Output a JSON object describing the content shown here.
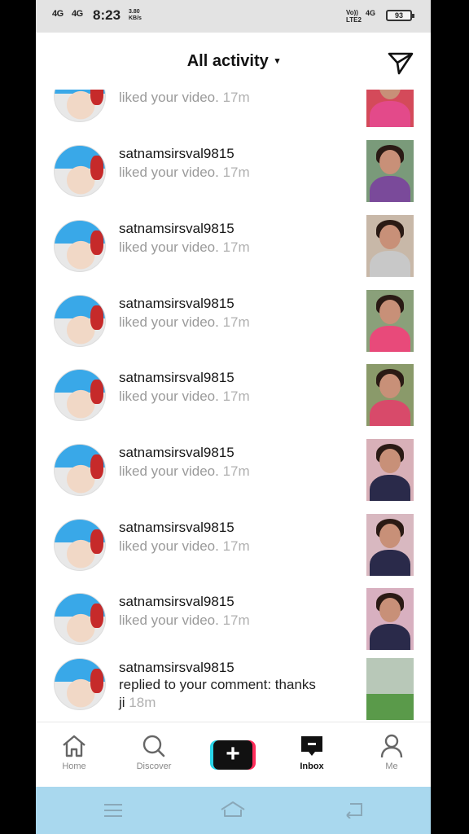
{
  "status_bar": {
    "signal_1": "4G",
    "signal_2": "4G",
    "time": "8:23",
    "speed_value": "3.80",
    "speed_unit": "KB/s",
    "volte": "Vo))",
    "lte": "LTE2",
    "network": "4G",
    "battery": "93"
  },
  "header": {
    "title": "All activity",
    "title_caret": "▾",
    "send_icon": "paper-plane-icon"
  },
  "notifications": [
    {
      "username": "",
      "action": "liked your video.",
      "time": "17m",
      "thumb": {
        "bg": "#d44a5a",
        "body": "#e34a8a"
      }
    },
    {
      "username": "satnamsirsval9815",
      "action": "liked your video.",
      "time": "17m",
      "thumb": {
        "bg": "#7a9a7a",
        "body": "#7a4a9a"
      }
    },
    {
      "username": "satnamsirsval9815",
      "action": "liked your video.",
      "time": "17m",
      "thumb": {
        "bg": "#c8b8a8",
        "body": "#c8c8c8"
      }
    },
    {
      "username": "satnamsirsval9815",
      "action": "liked your video.",
      "time": "17m",
      "thumb": {
        "bg": "#8aa07a",
        "body": "#e84a7a"
      }
    },
    {
      "username": "satnamsirsval9815",
      "action": "liked your video.",
      "time": "17m",
      "thumb": {
        "bg": "#8a9a6a",
        "body": "#d84a6a"
      }
    },
    {
      "username": "satnamsirsval9815",
      "action": "liked your video.",
      "time": "17m",
      "thumb": {
        "bg": "#d8b0b8",
        "body": "#2a2a4a"
      }
    },
    {
      "username": "satnamsirsval9815",
      "action": "liked your video.",
      "time": "17m",
      "thumb": {
        "bg": "#d8b8c0",
        "body": "#2a2a4a"
      }
    },
    {
      "username": "satnamsirsval9815",
      "action": "liked your video.",
      "time": "17m",
      "thumb": {
        "bg": "#d8b0c0",
        "body": "#2a2a4a"
      }
    }
  ],
  "comment_notification": {
    "username": "satnamsirsval9815",
    "text_line1": "replied to your comment: thanks",
    "text_line2": "ji",
    "time": "18m",
    "thumb": {
      "bg": "#b8c8b8",
      "body": "#4a8a3a"
    }
  },
  "bottom_nav": {
    "home": "Home",
    "discover": "Discover",
    "create": "+",
    "inbox": "Inbox",
    "me": "Me"
  },
  "colors": {
    "create_left": "#29d5e8",
    "create_right": "#ff2d5a",
    "android_bar": "#a9d8ee"
  }
}
